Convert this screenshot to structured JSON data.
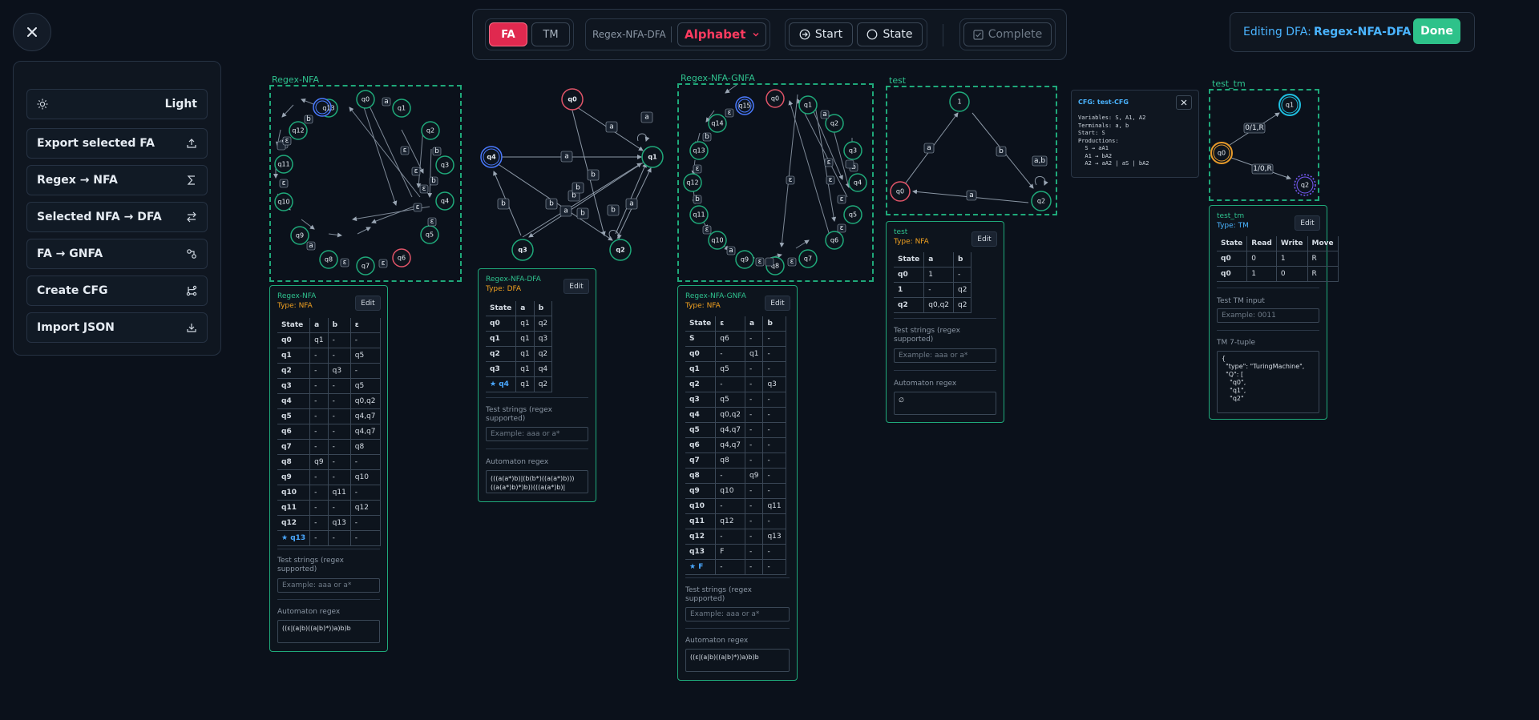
{
  "menu": {
    "items": [
      {
        "label": "Light",
        "icon": "sun-icon"
      },
      {
        "label": "Export selected FA",
        "icon": "upload-icon"
      },
      {
        "label": "Regex → NFA",
        "icon": "sigma-icon"
      },
      {
        "label": "Selected NFA → DFA",
        "icon": "swap-icon"
      },
      {
        "label": "FA → GNFA",
        "icon": "graph-icon"
      },
      {
        "label": "Create CFG",
        "icon": "branch-icon"
      },
      {
        "label": "Import JSON",
        "icon": "download-icon"
      }
    ]
  },
  "toolbar": {
    "fa_label": "FA",
    "tm_label": "TM",
    "current_name": "Regex-NFA-DFA",
    "alphabet_label": "Alphabet",
    "start_label": "Start",
    "state_label": "State",
    "complete_label": "Complete"
  },
  "editing": {
    "prefix": "Editing DFA:",
    "name": "Regex-NFA-DFA",
    "done_label": "Done"
  },
  "colors": {
    "accent": "#1fa97a",
    "fa_active": "#e0294f",
    "done": "#2ec28a",
    "edit_name": "#4ab4ff",
    "accepting": "#4a7aff",
    "start": "#e05468",
    "type": "#f0a020"
  },
  "automata": {
    "regex_nfa": {
      "title": "Regex-NFA",
      "states": [
        "q0",
        "q1",
        "q2",
        "q3",
        "q4",
        "q5",
        "q6",
        "q7",
        "q8",
        "q9",
        "q10",
        "q11",
        "q12",
        "q13"
      ],
      "edge_labels": [
        "b",
        "a",
        "b",
        "ε",
        "ε",
        "ε",
        "b",
        "ε",
        "ε",
        "a",
        "ε",
        "ε",
        "ε",
        "ε",
        "ε",
        "b"
      ]
    },
    "regex_nfa_dfa": {
      "title": "",
      "states": [
        "q0",
        "q1",
        "q2",
        "q3",
        "q4"
      ],
      "edge_labels": [
        "a",
        "a",
        "a",
        "b",
        "b",
        "b",
        "b",
        "b",
        "a",
        "b",
        "a",
        "b"
      ]
    },
    "regex_nfa_gnfa": {
      "title": "Regex-NFA-GNFA",
      "states": [
        "q0",
        "q1",
        "q2",
        "q3",
        "q4",
        "q5",
        "q6",
        "q7",
        "q8",
        "q9",
        "q10",
        "q11",
        "q12",
        "q13",
        "q14",
        "q15"
      ],
      "edge_labels": [
        "ε",
        "ε",
        "b",
        "ε",
        "ε",
        "ε",
        "ε",
        "b",
        "ε",
        "b",
        "ε",
        "ε",
        "ε",
        "a",
        "ε",
        "ε",
        "b",
        "ε",
        "ε",
        "ε",
        "a"
      ]
    },
    "test": {
      "title": "test",
      "states": [
        "1",
        "q0",
        "q2"
      ],
      "edge_labels": [
        "a",
        "b",
        "a",
        "a,b"
      ]
    },
    "test_tm": {
      "title": "test_tm",
      "states": [
        "q1",
        "q0",
        "q2"
      ],
      "edge_labels": [
        "0/1,R",
        "1/0,R"
      ]
    }
  },
  "cards": {
    "regex_nfa": {
      "name": "Regex-NFA",
      "type": "Type: NFA",
      "edit": "Edit",
      "headers": [
        "State",
        "a",
        "b",
        "ε"
      ],
      "rows": [
        [
          "q0",
          "q1",
          "-",
          "-"
        ],
        [
          "q1",
          "-",
          "-",
          "q5"
        ],
        [
          "q2",
          "-",
          "q3",
          "-"
        ],
        [
          "q3",
          "-",
          "-",
          "q5"
        ],
        [
          "q4",
          "-",
          "-",
          "q0,q2"
        ],
        [
          "q5",
          "-",
          "-",
          "q4,q7"
        ],
        [
          "q6",
          "-",
          "-",
          "q4,q7"
        ],
        [
          "q7",
          "-",
          "-",
          "q8"
        ],
        [
          "q8",
          "q9",
          "-",
          "-"
        ],
        [
          "q9",
          "-",
          "-",
          "q10"
        ],
        [
          "q10",
          "-",
          "q11",
          "-"
        ],
        [
          "q11",
          "-",
          "-",
          "q12"
        ],
        [
          "q12",
          "-",
          "q13",
          "-"
        ],
        [
          "★ q13",
          "-",
          "-",
          "-"
        ]
      ],
      "test_label": "Test strings (regex supported)",
      "test_placeholder": "Example: aaa or a*",
      "regex_label": "Automaton regex",
      "regex": "((ε|(a|b)((a|b)*))a)b)b"
    },
    "regex_nfa_dfa": {
      "name": "Regex-NFA-DFA",
      "type": "Type: DFA",
      "edit": "Edit",
      "headers": [
        "State",
        "a",
        "b"
      ],
      "rows": [
        [
          "q0",
          "q1",
          "q2"
        ],
        [
          "q1",
          "q1",
          "q3"
        ],
        [
          "q2",
          "q1",
          "q2"
        ],
        [
          "q3",
          "q1",
          "q4"
        ],
        [
          "★ q4",
          "q1",
          "q2"
        ]
      ],
      "test_label": "Test strings (regex supported)",
      "test_placeholder": "Example: aaa or a*",
      "regex_label": "Automaton regex",
      "regex": "(((a(a*)b)|(b(b*)((a(a*)b)))\n((a(a*)b)*)b))(((a(a*)b)|"
    },
    "regex_nfa_gnfa": {
      "name": "Regex-NFA-GNFA",
      "type": "Type: NFA",
      "edit": "Edit",
      "headers": [
        "State",
        "ε",
        "a",
        "b"
      ],
      "rows": [
        [
          "S",
          "q6",
          "-",
          "-"
        ],
        [
          "q0",
          "-",
          "q1",
          "-"
        ],
        [
          "q1",
          "q5",
          "-",
          "-"
        ],
        [
          "q2",
          "-",
          "-",
          "q3"
        ],
        [
          "q3",
          "q5",
          "-",
          "-"
        ],
        [
          "q4",
          "q0,q2",
          "-",
          "-"
        ],
        [
          "q5",
          "q4,q7",
          "-",
          "-"
        ],
        [
          "q6",
          "q4,q7",
          "-",
          "-"
        ],
        [
          "q7",
          "q8",
          "-",
          "-"
        ],
        [
          "q8",
          "-",
          "q9",
          "-"
        ],
        [
          "q9",
          "q10",
          "-",
          "-"
        ],
        [
          "q10",
          "-",
          "-",
          "q11"
        ],
        [
          "q11",
          "q12",
          "-",
          "-"
        ],
        [
          "q12",
          "-",
          "-",
          "q13"
        ],
        [
          "q13",
          "F",
          "-",
          "-"
        ],
        [
          "★ F",
          "-",
          "-",
          "-"
        ]
      ],
      "test_label": "Test strings (regex supported)",
      "test_placeholder": "Example: aaa or a*",
      "regex_label": "Automaton regex",
      "regex": "((ε|(a|b)((a|b)*))a)b)b"
    },
    "test": {
      "name": "test",
      "type": "Type: NFA",
      "edit": "Edit",
      "headers": [
        "State",
        "a",
        "b"
      ],
      "rows": [
        [
          "q0",
          "1",
          "-"
        ],
        [
          "1",
          "-",
          "q2"
        ],
        [
          "q2",
          "q0,q2",
          "q2"
        ]
      ],
      "test_label": "Test strings (regex supported)",
      "test_placeholder": "Example: aaa or a*",
      "regex_label": "Automaton regex",
      "regex": "∅"
    },
    "test_tm": {
      "name": "test_tm",
      "type": "Type: TM",
      "edit": "Edit",
      "headers": [
        "State",
        "Read",
        "Write",
        "Move"
      ],
      "rows": [
        [
          "q0",
          "0",
          "1",
          "R"
        ],
        [
          "q0",
          "1",
          "0",
          "R"
        ]
      ],
      "test_label": "Test TM input",
      "test_placeholder": "Example: 0011",
      "tuple_label": "TM 7-tuple",
      "tuple": "{\n  \"type\": \"TuringMachine\",\n  \"Q\": [\n    \"q0\",\n    \"q1\",\n    \"q2\""
    }
  },
  "cfg": {
    "title": "CFG: test-CFG",
    "body": "Variables: S, A1, A2\nTerminals: a, b\nStart: S\nProductions:\n  S → aA1\n  A1 → bA2\n  A2 → aA2 | aS | bA2"
  }
}
